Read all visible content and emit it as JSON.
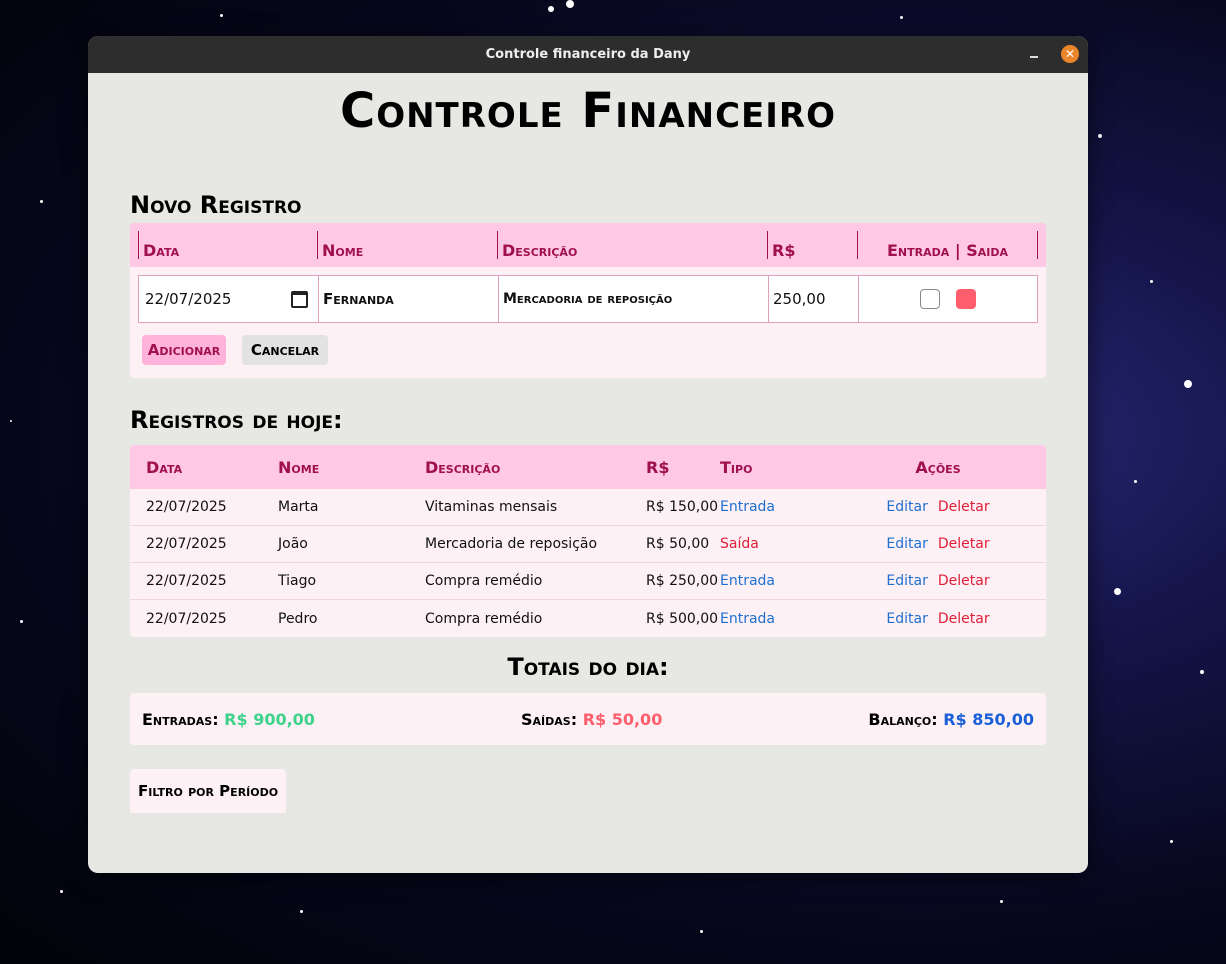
{
  "window": {
    "title": "Controle financeiro da Dany",
    "close_glyph": "✕"
  },
  "main_title": "Controle Financeiro",
  "novo_registro": {
    "title": "Novo Registro",
    "headers": [
      "Data",
      "Nome",
      "Descrição",
      "R$",
      "Entrada | Saida"
    ],
    "values": {
      "data": "22/07/2025",
      "nome": "Fernanda",
      "descricao": "Mercadoria de reposição",
      "valor": "250,00"
    },
    "entrada_checked": false,
    "saida_checked": true,
    "add_label": "Adicionar",
    "cancel_label": "Cancelar"
  },
  "registros": {
    "title": "Registros de hoje:",
    "headers": [
      "Data",
      "Nome",
      "Descrição",
      "R$",
      "Tipo",
      "Ações"
    ],
    "rows": [
      {
        "data": "22/07/2025",
        "nome": "Marta",
        "descricao": "Vitaminas mensais",
        "valor": "R$ 150,00",
        "tipo": "Entrada"
      },
      {
        "data": "22/07/2025",
        "nome": "João",
        "descricao": "Mercadoria de reposição",
        "valor": "R$ 50,00",
        "tipo": "Saída"
      },
      {
        "data": "22/07/2025",
        "nome": "Tiago",
        "descricao": "Compra remédio",
        "valor": "R$ 250,00",
        "tipo": "Entrada"
      },
      {
        "data": "22/07/2025",
        "nome": "Pedro",
        "descricao": "Compra remédio",
        "valor": "R$ 500,00",
        "tipo": "Entrada"
      }
    ],
    "edit_label": "Editar",
    "delete_label": "Deletar"
  },
  "totais": {
    "title": "Totais do dia:",
    "entradas_label": "Entradas:",
    "entradas_value": "R$ 900,00",
    "saidas_label": "Saídas:",
    "saidas_value": "R$ 50,00",
    "balanco_label": "Balanço:",
    "balanco_value": "R$ 850,00"
  },
  "filtro_label": "Filtro por Período",
  "colors": {
    "accent_pink": "#ffc9e6",
    "header_text": "#a0104f",
    "entrada": "#1e6fd0",
    "saida": "#e01e37",
    "total_green": "#3ed38a",
    "total_red": "#ff5f6d",
    "total_blue": "#1a5fd8"
  }
}
